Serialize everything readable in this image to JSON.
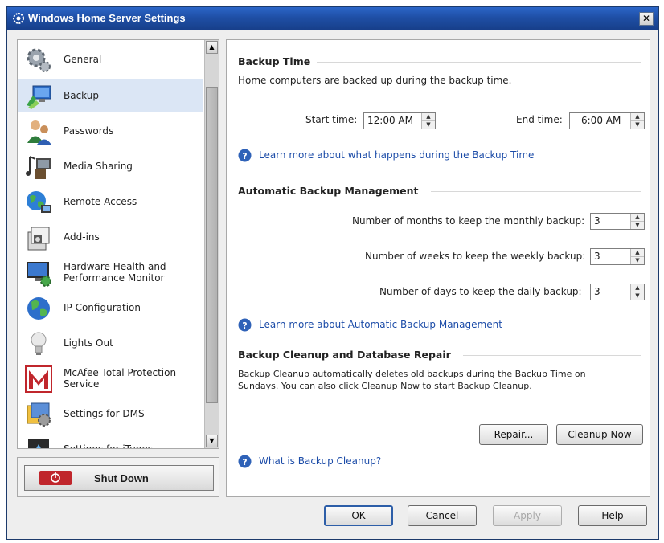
{
  "window": {
    "title": "Windows Home Server Settings",
    "close_glyph": "✕"
  },
  "sidebar": {
    "items": [
      {
        "label": "General",
        "icon": "gear-icon"
      },
      {
        "label": "Backup",
        "icon": "backup-icon"
      },
      {
        "label": "Passwords",
        "icon": "users-icon"
      },
      {
        "label": "Media Sharing",
        "icon": "media-icon"
      },
      {
        "label": "Remote Access",
        "icon": "globe-icon"
      },
      {
        "label": "Add-ins",
        "icon": "addins-icon"
      },
      {
        "label": "Hardware Health and Performance Monitor",
        "icon": "monitor-icon"
      },
      {
        "label": "IP Configuration",
        "icon": "network-icon"
      },
      {
        "label": "Lights Out",
        "icon": "lightbulb-icon"
      },
      {
        "label": "McAfee Total Protection Service",
        "icon": "mcafee-icon"
      },
      {
        "label": "Settings for DMS",
        "icon": "dms-icon"
      },
      {
        "label": "Settings for iTunes",
        "icon": "itunes-icon"
      }
    ],
    "selected": "Backup"
  },
  "shutdown": {
    "label": "Shut Down"
  },
  "backup_time": {
    "title": "Backup Time",
    "description": "Home computers are backed up during the backup time.",
    "start_label": "Start time:",
    "start_value": "12:00 AM",
    "end_label": "End time:",
    "end_value": "6:00 AM",
    "link": "Learn more about what happens during the Backup Time"
  },
  "auto_backup": {
    "title": "Automatic Backup Management",
    "monthly_label": "Number of months to keep the monthly backup:",
    "monthly_value": "3",
    "weekly_label": "Number of weeks to keep the weekly backup:",
    "weekly_value": "3",
    "daily_label": "Number of days to keep the daily backup:",
    "daily_value": "3",
    "link": "Learn more about Automatic Backup Management"
  },
  "cleanup": {
    "title": "Backup Cleanup and Database Repair",
    "description": "Backup Cleanup automatically deletes old backups during the Backup Time on Sundays.  You can also click Cleanup Now to start Backup Cleanup.",
    "repair_button": "Repair...",
    "cleanup_button": "Cleanup Now",
    "link": "What is Backup Cleanup?"
  },
  "footer": {
    "ok": "OK",
    "cancel": "Cancel",
    "apply": "Apply",
    "help": "Help"
  },
  "colors": {
    "title_bar": "#1f4fa6",
    "link": "#1c4ca8",
    "selected_item": "#dbe6f5",
    "shutdown_red": "#c0262c"
  }
}
